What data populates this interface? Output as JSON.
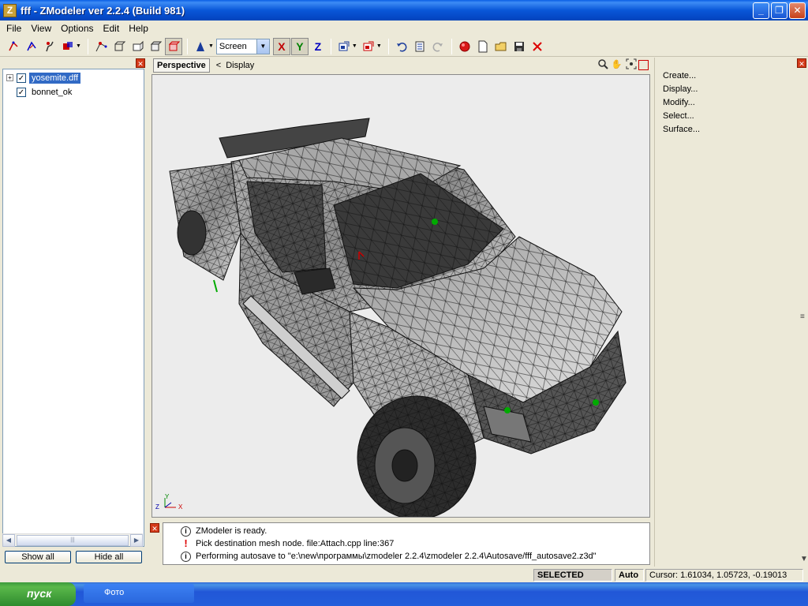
{
  "window": {
    "title": "fff - ZModeler ver 2.2.4 (Build 981)",
    "icon": "Z"
  },
  "menu": [
    {
      "label": "File"
    },
    {
      "label": "View"
    },
    {
      "label": "Options"
    },
    {
      "label": "Edit"
    },
    {
      "label": "Help"
    }
  ],
  "toolbar": {
    "coord_mode": "Screen",
    "axis_x": "X",
    "axis_y": "Y",
    "axis_z": "Z"
  },
  "tree": {
    "items": [
      {
        "label": "yosemite.dff",
        "selected": true,
        "checked": true,
        "expandable": true
      },
      {
        "label": "bonnet_ok",
        "selected": false,
        "checked": true,
        "expandable": false
      }
    ],
    "expander_symbol": "+",
    "check_symbol": "✓"
  },
  "left_buttons": {
    "show_all": "Show all",
    "hide_all": "Hide all"
  },
  "viewport": {
    "tab": "Perspective",
    "display_arrow": "<",
    "display_label": "Display",
    "axis_z": "Z",
    "axis_x": "X",
    "axis_y": "Y"
  },
  "log": [
    {
      "type": "info",
      "text": "ZModeler is ready."
    },
    {
      "type": "warn",
      "text": "Pick destination mesh node. file:Attach.cpp line:367"
    },
    {
      "type": "info",
      "text": "Performing autosave to \"e:\\new\\программы\\zmodeler 2.2.4\\zmodeler 2.2.4\\Autosave/fff_autosave2.z3d\""
    }
  ],
  "command_panel": [
    {
      "label": "Create..."
    },
    {
      "label": "Display..."
    },
    {
      "label": "Modify..."
    },
    {
      "label": "Select..."
    },
    {
      "label": "Surface..."
    }
  ],
  "status": {
    "mode": "SELECTED MODE",
    "auto": "Auto",
    "cursor": "Cursor: 1.61034, 1.05723, -0.19013"
  },
  "taskbar": {
    "start": "пуск",
    "task": "Фото"
  }
}
